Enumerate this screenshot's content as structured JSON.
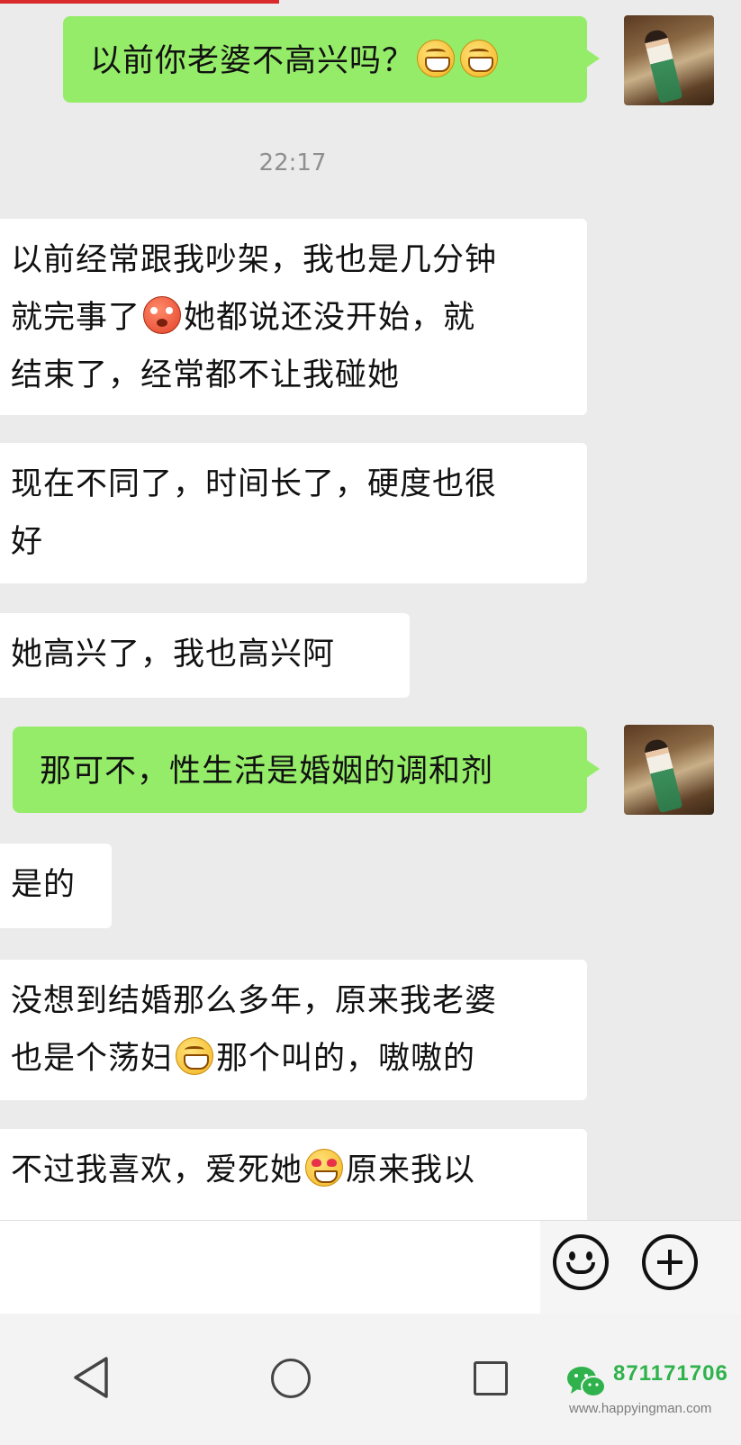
{
  "messages": [
    {
      "side": "out",
      "text": "以前你老婆不高兴吗？",
      "emoji": [
        "grin-icon",
        "grin-icon"
      ]
    },
    {
      "side": "in",
      "lines": [
        "以前经常跟我吵架，我也是几分钟",
        "就完事了",
        "她都说还没开始，就",
        "结束了，经常都不让我碰她"
      ]
    },
    {
      "side": "in",
      "lines": [
        "现在不同了，时间长了，硬度也很",
        "好"
      ]
    },
    {
      "side": "in",
      "text": "她高兴了，我也高兴阿"
    },
    {
      "side": "out",
      "text": "那可不，性生活是婚姻的调和剂"
    },
    {
      "side": "in",
      "text": "是的"
    },
    {
      "side": "in",
      "lines": [
        "没想到结婚那么多年，原来我老婆",
        "也是个荡妇",
        "那个叫的，嗷嗷的"
      ]
    },
    {
      "side": "in",
      "lines": [
        "不过我喜欢，爱死她",
        "原来我以"
      ]
    }
  ],
  "timestamp": "22:17",
  "watermark": {
    "id": "871171706",
    "url": "www.happyingman.com"
  },
  "colors": {
    "outgoing": "#95ec69",
    "incoming": "#ffffff",
    "background": "#ebebeb",
    "watermark": "#2fb24c"
  }
}
